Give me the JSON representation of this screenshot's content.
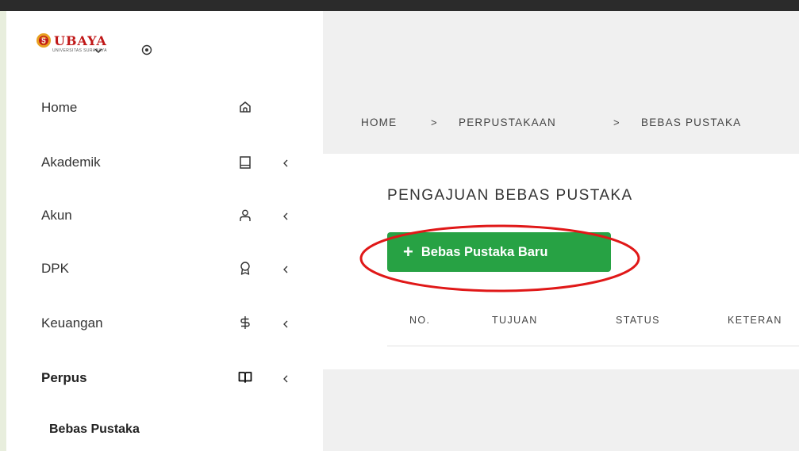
{
  "brand": {
    "name": "UBAYA",
    "subtitle": "UNIVERSITAS SURABAYA",
    "logo_color": "#c01818"
  },
  "header_icons": [
    "chevron-down-icon",
    "radio-icon"
  ],
  "sidebar": {
    "items": [
      {
        "label": "Home",
        "icon": "home-icon",
        "has_submenu": false
      },
      {
        "label": "Akademik",
        "icon": "book-icon",
        "has_submenu": true
      },
      {
        "label": "Akun",
        "icon": "user-icon",
        "has_submenu": true
      },
      {
        "label": "DPK",
        "icon": "award-icon",
        "has_submenu": true
      },
      {
        "label": "Keuangan",
        "icon": "dollar-icon",
        "has_submenu": true
      },
      {
        "label": "Perpus",
        "icon": "open-book-icon",
        "has_submenu": true,
        "active": true
      }
    ],
    "subitem": "Bebas Pustaka"
  },
  "breadcrumb": [
    "HOME",
    "PERPUSTAKAAN",
    "BEBAS PUSTAKA"
  ],
  "breadcrumb_separator": ">",
  "main": {
    "title": "PENGAJUAN BEBAS PUSTAKA",
    "new_button_label": "Bebas Pustaka Baru",
    "new_button_color": "#27a244",
    "highlight_color": "#e01818"
  },
  "table": {
    "headers": [
      "NO.",
      "TUJUAN",
      "STATUS",
      "KETERAN"
    ]
  }
}
